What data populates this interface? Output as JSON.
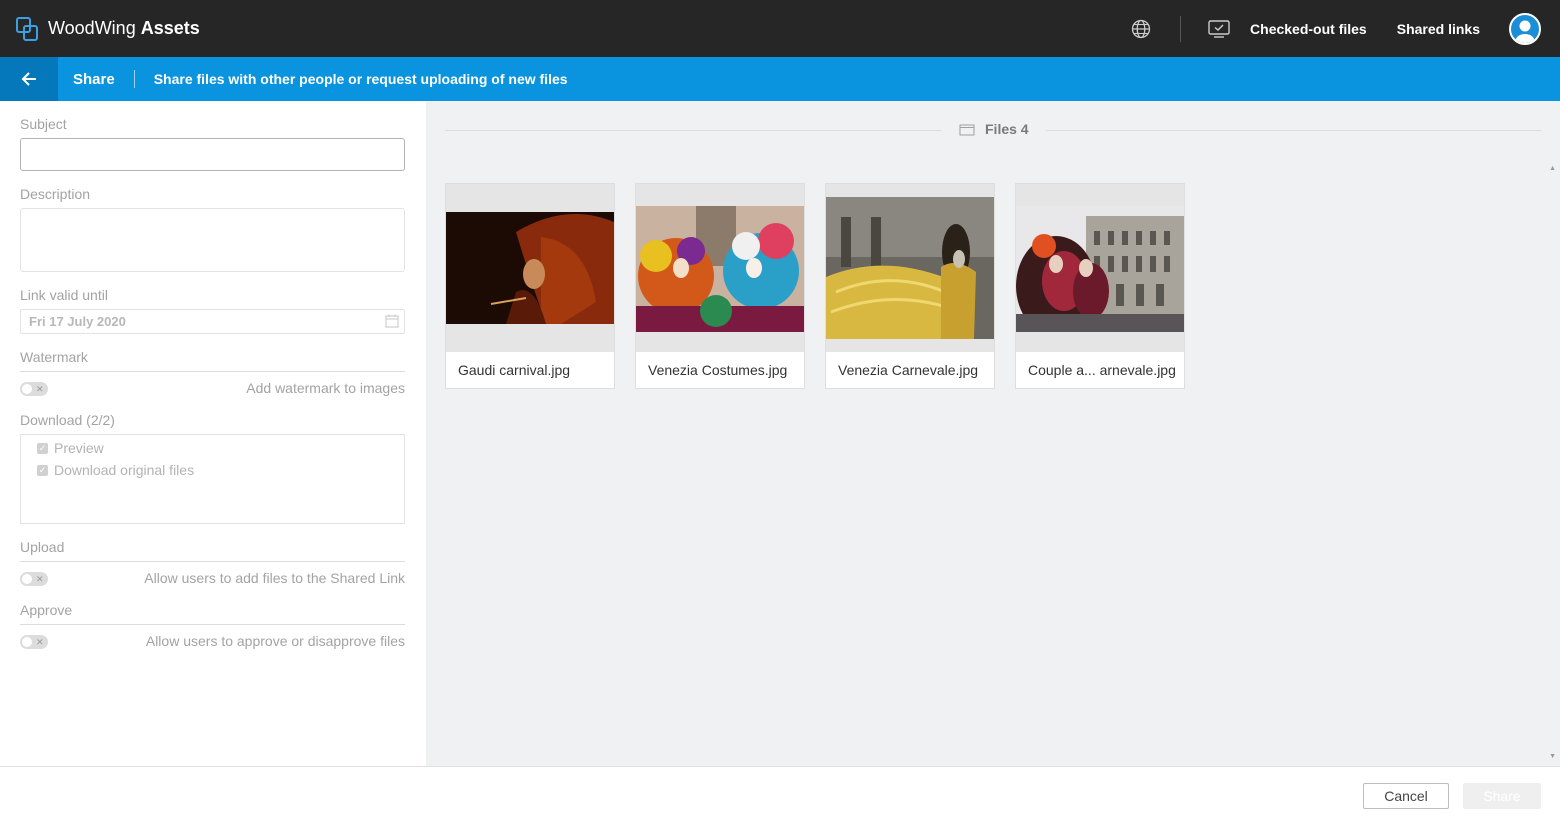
{
  "topbar": {
    "brand_light": "WoodWing",
    "brand_bold": "Assets",
    "checked_out": "Checked-out files",
    "shared_links": "Shared links"
  },
  "bluebar": {
    "title": "Share",
    "subtitle": "Share files with other people or request uploading of new files"
  },
  "form": {
    "subject_label": "Subject",
    "subject_value": "",
    "description_label": "Description",
    "description_value": "",
    "link_valid_label": "Link valid until",
    "link_valid_value": "Fri 17 July 2020",
    "watermark_label": "Watermark",
    "watermark_toggle": "Add watermark to images",
    "download_label": "Download (2/2)",
    "download_options": [
      "Preview",
      "Download original files"
    ],
    "upload_label": "Upload",
    "upload_toggle": "Allow users to add files to the Shared Link",
    "approve_label": "Approve",
    "approve_toggle": "Allow users to approve or disapprove files"
  },
  "files": {
    "heading": "Files 4",
    "items": [
      {
        "name": "Gaudi carnival.jpg"
      },
      {
        "name": "Venezia Costumes.jpg"
      },
      {
        "name": "Venezia Carnevale.jpg"
      },
      {
        "name": "Couple a... arnevale.jpg"
      }
    ]
  },
  "footer": {
    "cancel": "Cancel",
    "share": "Share"
  },
  "colors": {
    "topbar": "#262626",
    "accent": "#0a93de",
    "accent_dark": "#0578bb"
  }
}
